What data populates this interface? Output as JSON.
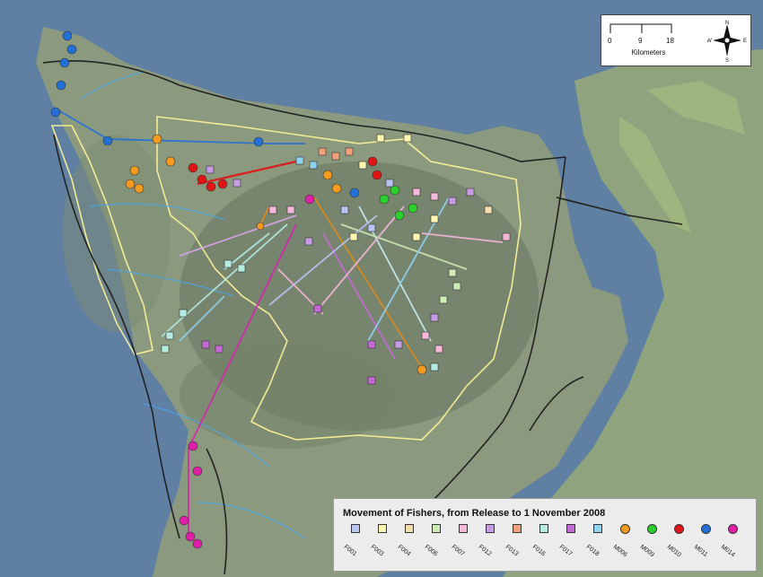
{
  "legend": {
    "title": "Movement of Fishers, from Release to 1 November 2008",
    "items": [
      {
        "label": "F001",
        "shape": "square",
        "color": "#b9c4f0"
      },
      {
        "label": "F003",
        "shape": "square",
        "color": "#fff7b0"
      },
      {
        "label": "F004",
        "shape": "square",
        "color": "#f2deb0"
      },
      {
        "label": "F006",
        "shape": "square",
        "color": "#cdebb6"
      },
      {
        "label": "F007",
        "shape": "square",
        "color": "#f6b8d8"
      },
      {
        "label": "F012",
        "shape": "square",
        "color": "#c79be3"
      },
      {
        "label": "F013",
        "shape": "square",
        "color": "#f0a27a"
      },
      {
        "label": "F016",
        "shape": "square",
        "color": "#b5ece2"
      },
      {
        "label": "F017",
        "shape": "square",
        "color": "#c46ad6"
      },
      {
        "label": "F018",
        "shape": "square",
        "color": "#8fd3ee"
      },
      {
        "label": "M006",
        "shape": "circle",
        "color": "#f39a1f"
      },
      {
        "label": "M009",
        "shape": "circle",
        "color": "#2bd12b"
      },
      {
        "label": "M010",
        "shape": "circle",
        "color": "#e01616"
      },
      {
        "label": "M011",
        "shape": "circle",
        "color": "#2370d8"
      },
      {
        "label": "M014",
        "shape": "circle",
        "color": "#e01ea8"
      }
    ]
  },
  "scalebar": {
    "ticks": [
      "0",
      "9",
      "18"
    ],
    "unit": "Kilometers"
  },
  "north_arrow": {
    "n": "N",
    "s": "S",
    "e": "E",
    "w": "W"
  },
  "colors": {
    "water": "#5f7fa3",
    "land": "#8a9a80",
    "mountains": "#6f7d67",
    "boundary": "#fff59a",
    "roads": "#222222",
    "rivers": "#4aa6e8"
  }
}
